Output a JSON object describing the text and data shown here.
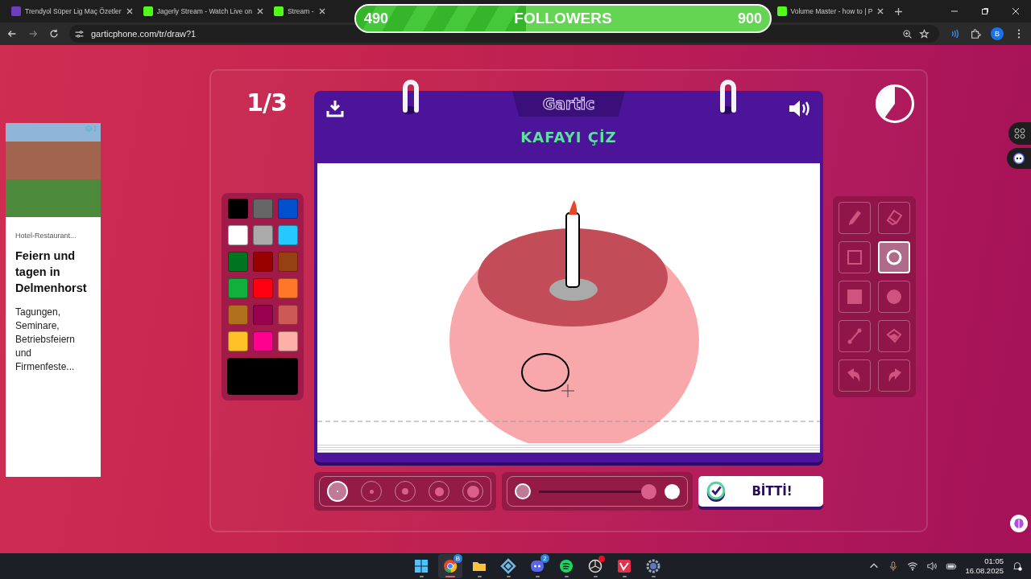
{
  "browser": {
    "tabs": [
      {
        "title": "Trendyol Süper Lig Maç Özetler",
        "selected": false
      },
      {
        "title": "Jagerly Stream - Watch Live on",
        "selected": false
      },
      {
        "title": "Stream -",
        "selected": false
      },
      {
        "title": "Volume Master - how to | P",
        "selected": false
      }
    ],
    "url": "garticphone.com/tr/draw?1",
    "profile": "B"
  },
  "followers_overlay": {
    "current": "490",
    "label": "FOLLOWERS",
    "goal": "900",
    "level": 0.41
  },
  "ad": {
    "advertiser": "Hotel-Restaurant...",
    "headline": "Feiern und tagen in Delmenhorst",
    "body": "Tagungen, Seminare, Betriebsfeiern und Firmenfeste..."
  },
  "game": {
    "round": "1/3",
    "timer": {
      "level": 0.4
    },
    "logo": "Gartic",
    "title": "KAFAYI ÇİZ",
    "palette": {
      "colors": [
        {
          "color": "#000000"
        },
        {
          "color": "#666666"
        },
        {
          "color": "#0050cd"
        },
        {
          "color": "#ffffff"
        },
        {
          "color": "#aaaaaa"
        },
        {
          "color": "#26c9ff"
        },
        {
          "color": "#017420"
        },
        {
          "color": "#990000"
        },
        {
          "color": "#964112"
        },
        {
          "color": "#11b03c"
        },
        {
          "color": "#ff0013"
        },
        {
          "color": "#ff7829"
        },
        {
          "color": "#b0701c"
        },
        {
          "color": "#99004e"
        },
        {
          "color": "#cb5a57"
        },
        {
          "color": "#ffc126"
        },
        {
          "color": "#ff008f"
        },
        {
          "color": "#feafa8"
        }
      ],
      "current": {
        "color": "#000000"
      }
    },
    "tools": [
      {
        "kind": "pencil",
        "selected": false
      },
      {
        "kind": "eraser",
        "selected": false
      },
      {
        "kind": "rectangle",
        "selected": false
      },
      {
        "kind": "ellipse",
        "selected": true
      },
      {
        "kind": "filled-rectangle",
        "selected": false
      },
      {
        "kind": "filled-ellipse",
        "selected": false
      },
      {
        "kind": "line",
        "selected": false
      },
      {
        "kind": "bucket",
        "selected": false
      },
      {
        "kind": "undo",
        "selected": false
      },
      {
        "kind": "redo",
        "selected": false
      }
    ],
    "brush_sizes": [
      {
        "selected": true
      },
      {
        "selected": false
      },
      {
        "selected": false
      },
      {
        "selected": false
      },
      {
        "selected": false
      }
    ],
    "opacity": {
      "level": 1.0
    },
    "done_button": "BİTTİ!"
  },
  "taskbar": {
    "apps": [
      {
        "kind": "start",
        "selected": false,
        "alert": false
      },
      {
        "kind": "browser",
        "selected": true,
        "alert": false,
        "badge": "B"
      },
      {
        "kind": "folder",
        "selected": false,
        "alert": false
      },
      {
        "kind": "diamond",
        "selected": false,
        "alert": false
      },
      {
        "kind": "chat",
        "selected": false,
        "alert": false,
        "badge": "2"
      },
      {
        "kind": "music",
        "selected": false,
        "alert": false
      },
      {
        "kind": "aperture",
        "selected": false,
        "alert": true
      },
      {
        "kind": "v-logo",
        "selected": false,
        "alert": false
      },
      {
        "kind": "gear",
        "selected": false,
        "alert": false
      }
    ],
    "clock": {
      "time": "01:05",
      "date": "16.08.2025"
    }
  }
}
